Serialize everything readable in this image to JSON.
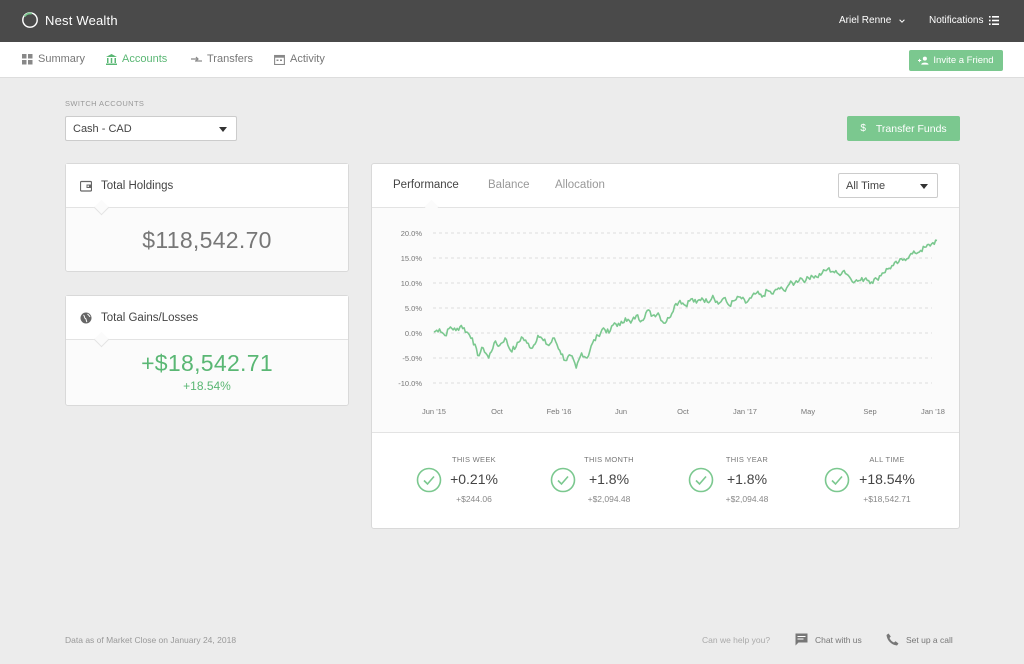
{
  "header": {
    "brand": "Nest Wealth",
    "user": "Ariel Renne",
    "notifications": "Notifications"
  },
  "nav": {
    "items": [
      {
        "label": "Summary",
        "icon": "grid-icon"
      },
      {
        "label": "Accounts",
        "icon": "bank-icon"
      },
      {
        "label": "Transfers",
        "icon": "transfer-icon"
      },
      {
        "label": "Activity",
        "icon": "calendar-icon"
      }
    ],
    "active": "Accounts",
    "invite_label": "Invite a Friend"
  },
  "accounts": {
    "switch_label": "SWITCH ACCOUNTS",
    "selected": "Cash - CAD",
    "transfer_label": "Transfer Funds",
    "transfer_icon": "$"
  },
  "holdings": {
    "title": "Total Holdings",
    "value": "$118,542.70"
  },
  "gains": {
    "title": "Total Gains/Losses",
    "value": "+$18,542.71",
    "percent": "+18.54%"
  },
  "performance": {
    "tabs": [
      "Performance",
      "Balance",
      "Allocation"
    ],
    "active_tab": "Performance",
    "range": "All Time",
    "stats": [
      {
        "label": "THIS WEEK",
        "value": "+0.21%",
        "sub": "+$244.06"
      },
      {
        "label": "THIS MONTH",
        "value": "+1.8%",
        "sub": "+$2,094.48"
      },
      {
        "label": "THIS YEAR",
        "value": "+1.8%",
        "sub": "+$2,094.48"
      },
      {
        "label": "ALL TIME",
        "value": "+18.54%",
        "sub": "+$18,542.71"
      }
    ]
  },
  "chart_data": {
    "type": "line",
    "title": "",
    "xlabel": "",
    "ylabel": "",
    "y_ticks": [
      "20.0%",
      "15.0%",
      "10.0%",
      "5.0%",
      "0.0%",
      "-5.0%",
      "-10.0%"
    ],
    "x_ticks": [
      "Jun '15",
      "Oct",
      "Feb '16",
      "Jun",
      "Oct",
      "Jan '17",
      "May",
      "Sep",
      "Jan '18"
    ],
    "ylim": [
      -10,
      20
    ],
    "grid": true,
    "line_color": "#7bc88f",
    "series": [
      {
        "values": [
          0.2,
          0.8,
          -0.5,
          1.2,
          0.5,
          1.5,
          0.2,
          -1.0,
          -4.5,
          -3.0,
          -5.0,
          -2.0,
          -2.5,
          -1.0,
          -3.5,
          -2.8,
          -0.8,
          -2.0,
          -3.0,
          -0.5,
          -1.5,
          -2.5,
          -1.0,
          -3.5,
          -5.5,
          -4.5,
          -7.0,
          -4.0,
          -5.0,
          -2.0,
          -0.5,
          1.0,
          0.0,
          2.0,
          1.5,
          3.0,
          2.0,
          3.5,
          2.5,
          4.5,
          3.5,
          4.0,
          2.0,
          3.0,
          5.5,
          6.5,
          5.5,
          6.8,
          6.0,
          7.0,
          6.2,
          7.5,
          5.8,
          7.0,
          5.5,
          6.5,
          7.2,
          6.0,
          7.0,
          8.0,
          7.2,
          8.5,
          7.8,
          9.0,
          8.5,
          9.8,
          10.0,
          11.0,
          10.5,
          11.5,
          11.2,
          12.0,
          12.8,
          12.3,
          11.8,
          12.5,
          11.2,
          10.3,
          10.5,
          11.0,
          10.2,
          10.8,
          12.0,
          12.8,
          13.5,
          14.2,
          14.8,
          15.5,
          16.0,
          16.5,
          17.2,
          17.8,
          18.5
        ]
      }
    ]
  },
  "footer": {
    "data_as_of": "Data as of Market Close on January 24, 2018",
    "help": "Can we help you?",
    "chat": "Chat with us",
    "call": "Set up a call"
  }
}
